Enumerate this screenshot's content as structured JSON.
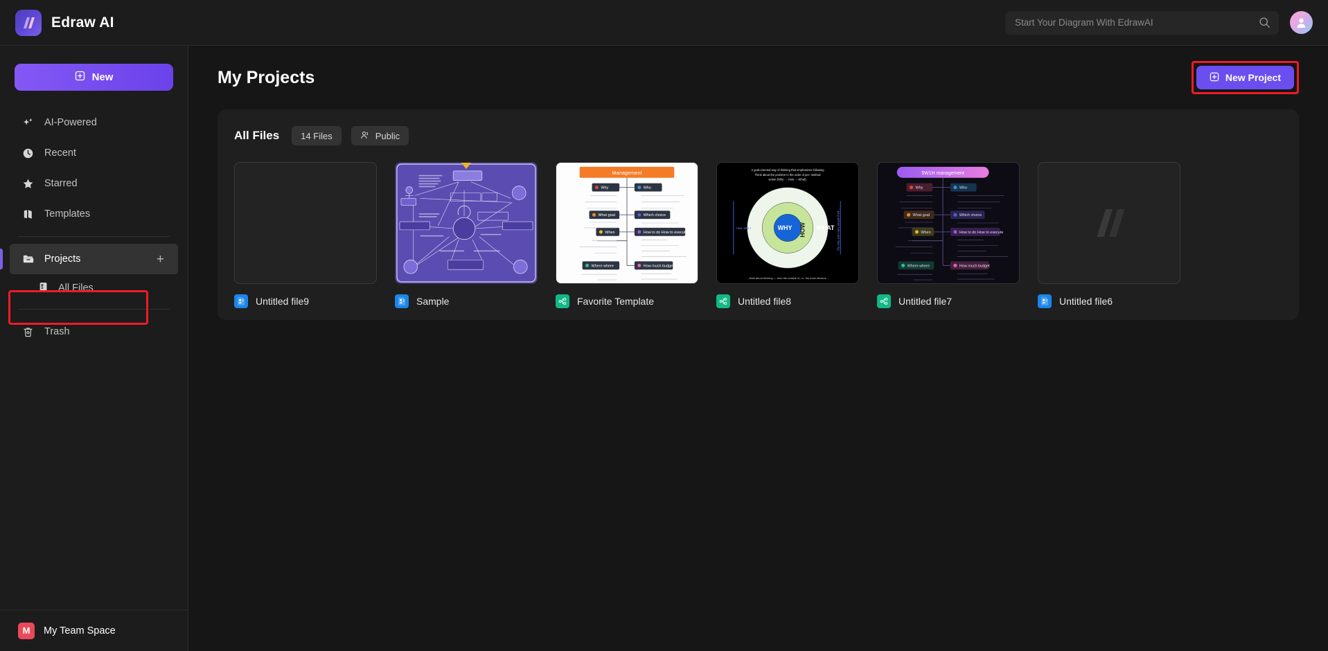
{
  "app": {
    "brand_name": "Edraw AI",
    "logo_icon": "edraw-logo-icon"
  },
  "header": {
    "search": {
      "placeholder": "Start Your Diagram With EdrawAI",
      "value": "",
      "icon": "search-icon"
    },
    "avatar_icon": "user-avatar-icon"
  },
  "sidebar": {
    "new_button": {
      "label": "New",
      "icon": "plus-square-icon"
    },
    "items": [
      {
        "label": "AI-Powered",
        "icon": "sparkle-icon"
      },
      {
        "label": "Recent",
        "icon": "clock-icon"
      },
      {
        "label": "Starred",
        "icon": "star-icon"
      },
      {
        "label": "Templates",
        "icon": "templates-icon"
      }
    ],
    "projects": {
      "label": "Projects",
      "icon": "folder-icon",
      "add_icon": "plus-icon",
      "add_label": "+",
      "sub_item": {
        "label": "All Files",
        "icon": "files-icon"
      }
    },
    "trash": {
      "label": "Trash",
      "icon": "trash-icon"
    },
    "teamspace": {
      "badge": "M",
      "label": "My Team Space"
    }
  },
  "main": {
    "page_title": "My Projects",
    "new_project_button": {
      "label": "New Project",
      "icon": "plus-square-icon"
    },
    "tabs": {
      "all_files_label": "All Files",
      "file_count_label": "14 Files",
      "public_label": "Public",
      "public_icon": "people-icon"
    },
    "files": [
      {
        "name": "Untitled file9",
        "type_color": "blue",
        "type_icon": "doc-blue-icon",
        "thumb": "empty"
      },
      {
        "name": "Sample",
        "type_color": "blue",
        "type_icon": "doc-blue-icon",
        "thumb": "uml-purple"
      },
      {
        "name": "Favorite Template",
        "type_color": "green",
        "type_icon": "doc-green-icon",
        "thumb": "mindmap-light"
      },
      {
        "name": "Untitled file8",
        "type_color": "green",
        "type_icon": "doc-green-icon",
        "thumb": "golden-circle"
      },
      {
        "name": "Untitled file7",
        "type_color": "green",
        "type_icon": "doc-green-icon",
        "thumb": "mindmap-dark"
      },
      {
        "name": "Untitled file6",
        "type_color": "blue",
        "type_icon": "doc-blue-icon",
        "thumb": "logo-placeholder"
      }
    ],
    "thumb_text": {
      "mindmap_light_title": "Management",
      "mindmap_light_nodes": [
        "Why",
        "Who",
        "What goal",
        "Which choice",
        "When",
        "How to do How to execute",
        "Where where",
        "How much budget"
      ],
      "mindmap_dark_title": "5W1H management",
      "golden_circle_labels": [
        "WHY",
        "HOW",
        "WHAT"
      ]
    }
  },
  "colors": {
    "accent": "#6b4ef0",
    "annotation": "#ee1c25",
    "blue_file": "#1a86e8",
    "green_file": "#12b886",
    "team_badge": "#e84a5a"
  }
}
